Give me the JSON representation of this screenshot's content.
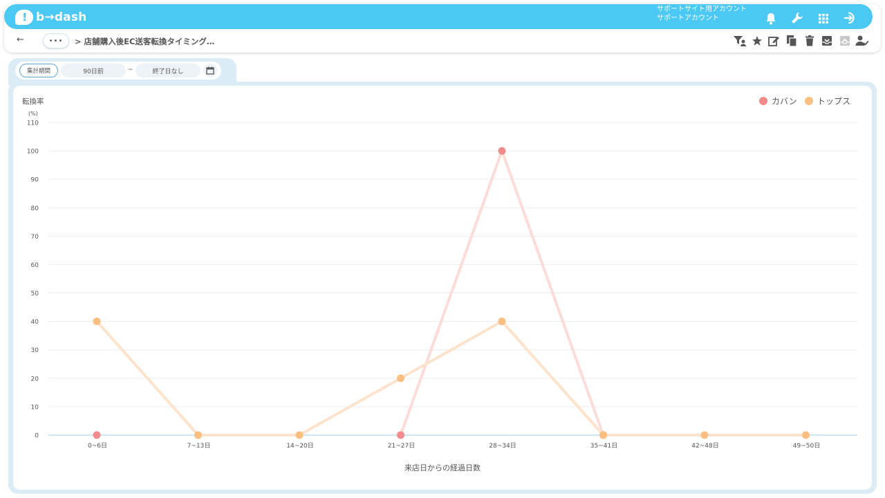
{
  "header": {
    "logo_text": "b→dash",
    "account_line1": "サポートサイト用アカウント",
    "account_line2": "サポートアカウント",
    "icons": [
      "bell-icon",
      "wrench-icon",
      "apps-grid-icon",
      "logout-icon"
    ]
  },
  "nav": {
    "back_label": "←",
    "more_label": "•••",
    "breadcrumb": "> 店舗購入後EC送客転換タイミング…",
    "toolbar_icons": [
      "filter-user-icon",
      "star-icon",
      "edit-icon",
      "copy-icon",
      "trash-icon",
      "archive-icon",
      "unarchive-icon",
      "user-check-icon"
    ]
  },
  "filter": {
    "period_label": "集計期間",
    "from_value": "90日前",
    "separator": "~",
    "to_value": "終了日なし"
  },
  "colors": {
    "brand": "#4cc8f4",
    "kaban": "#f28b8b",
    "kaban_line": "#fcdcd9",
    "tops": "#fbbf82",
    "tops_line": "#fde3cb",
    "axis_base": "#cfe6f3"
  },
  "chart_data": {
    "type": "line",
    "title": "",
    "ylabel": "転換率",
    "yunit": "(%)",
    "xlabel": "来店日からの経過日数",
    "ylim": [
      0,
      110
    ],
    "yticks": [
      0,
      10,
      20,
      30,
      40,
      50,
      60,
      70,
      80,
      90,
      100,
      110
    ],
    "grid": true,
    "legend_position": "top-right",
    "categories": [
      "0~6日",
      "7~13日",
      "14~20日",
      "21~27日",
      "28~34日",
      "35~41日",
      "42~48日",
      "49~50日"
    ],
    "series": [
      {
        "name": "カバン",
        "values": [
          0,
          null,
          null,
          0,
          100,
          0,
          null,
          null
        ]
      },
      {
        "name": "トップス",
        "values": [
          40,
          0,
          0,
          20,
          40,
          0,
          0,
          0
        ]
      }
    ]
  }
}
